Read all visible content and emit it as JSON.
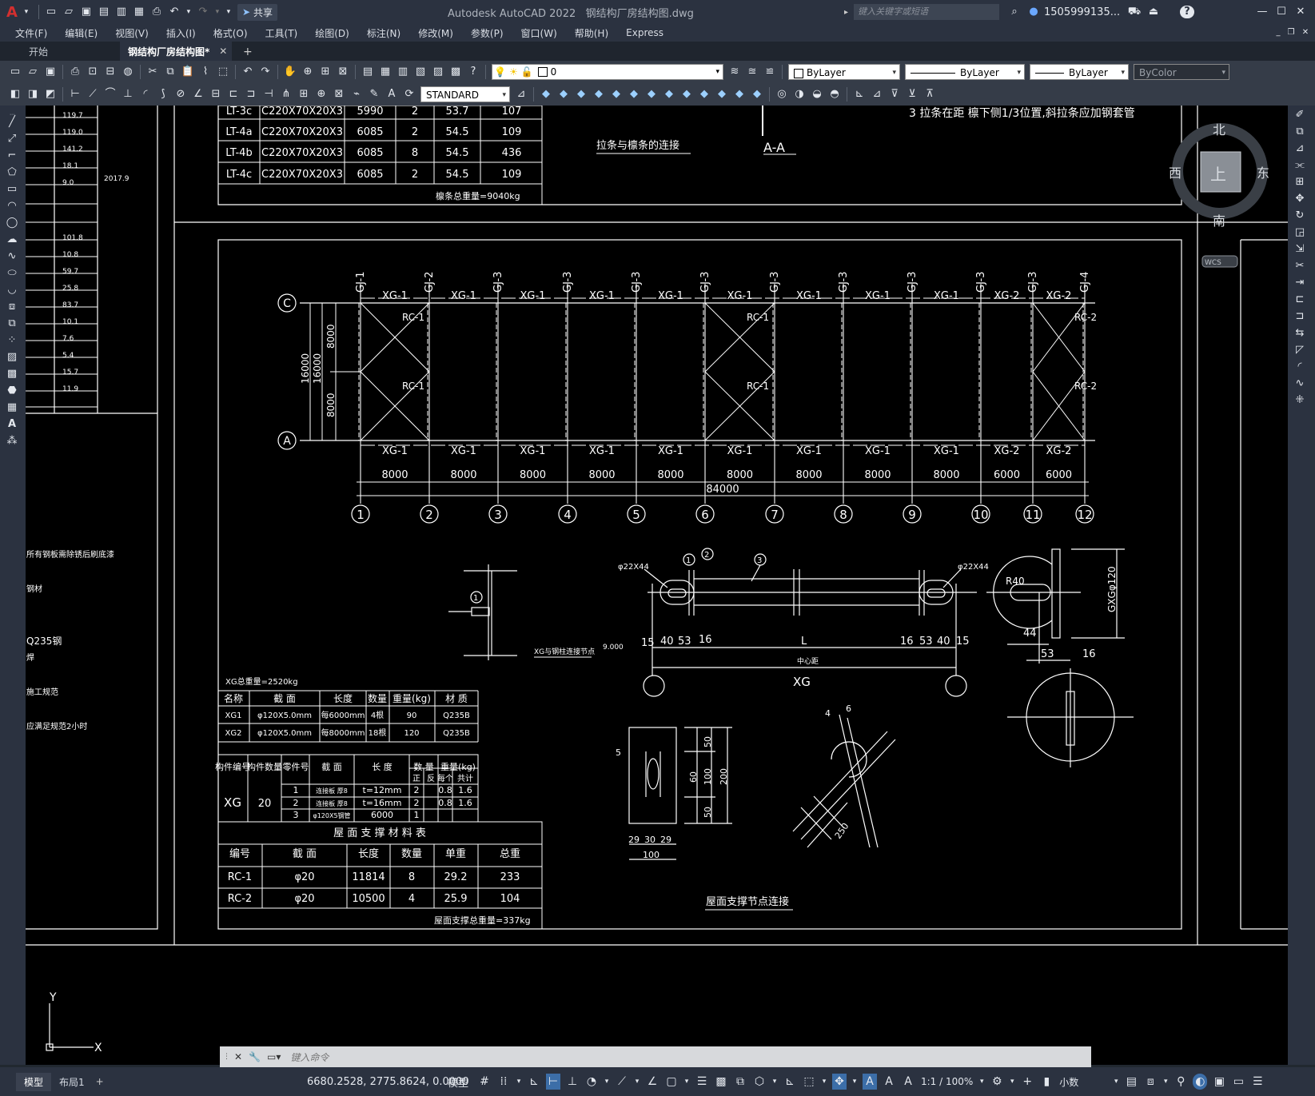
{
  "app": {
    "title": "Autodesk AutoCAD 2022",
    "filename": "钢结构厂房结构图.dwg",
    "search_placeholder": "键入关键字或短语",
    "user": "1505999135...",
    "share_label": "共享",
    "accent_color": "#d32f2f"
  },
  "menu": [
    "文件(F)",
    "编辑(E)",
    "视图(V)",
    "插入(I)",
    "格式(O)",
    "工具(T)",
    "绘图(D)",
    "标注(N)",
    "修改(M)",
    "参数(P)",
    "窗口(W)",
    "帮助(H)",
    "Express"
  ],
  "tabs": {
    "start": "开始",
    "doc": "钢结构厂房结构图*"
  },
  "properties": {
    "layer": "0",
    "color": "ByLayer",
    "linetype": "ByLayer",
    "lineweight": "ByLayer",
    "plotstyle": "ByColor",
    "textstyle": "STANDARD"
  },
  "viewcube": {
    "north": "北",
    "south": "南",
    "east": "东",
    "west": "西",
    "face": "上",
    "wcs": "WCS"
  },
  "drawing": {
    "top_table": {
      "rows": [
        [
          "LT-3c",
          "C220X70X20X3",
          "5990",
          "2",
          "53.7",
          "107"
        ],
        [
          "LT-4a",
          "C220X70X20X3",
          "6085",
          "2",
          "54.5",
          "109"
        ],
        [
          "LT-4b",
          "C220X70X20X3",
          "6085",
          "8",
          "54.5",
          "436"
        ],
        [
          "LT-4c",
          "C220X70X20X3",
          "6085",
          "2",
          "54.5",
          "109"
        ]
      ],
      "total": "檩条总重量=9040kg"
    },
    "left_column_values": [
      "119.7",
      "119.0",
      "141.2",
      "18.1",
      "9.0",
      "101.8",
      "10.8",
      "59.7",
      "25.8",
      "83.7",
      "10.1",
      "7.6",
      "5.4",
      "15.7",
      "11.9"
    ],
    "left_date": "2017.9",
    "left_notes": [
      "所有钢板需除锈后刷底漆",
      "钢材",
      "Q235钢",
      "焊",
      "施工规范",
      "应满足规范2小时"
    ],
    "note3": "3  拉条在距 檩下侧1/3位置,斜拉条应加钢套管",
    "caption_purlin": "拉条与檩条的连接",
    "section_aa": "A-A",
    "plan": {
      "frames": [
        "GJ-1",
        "GJ-2",
        "GJ-3",
        "GJ-3",
        "GJ-3",
        "GJ-3",
        "GJ-3",
        "GJ-3",
        "GJ-3",
        "GJ-3",
        "GJ-3",
        "GJ-4"
      ],
      "axes": [
        "1",
        "2",
        "3",
        "4",
        "5",
        "6",
        "7",
        "8",
        "9",
        "10",
        "11",
        "12"
      ],
      "rows": [
        "C",
        "A"
      ],
      "ties": [
        "XG-1",
        "XG-1",
        "XG-1",
        "XG-1",
        "XG-1",
        "XG-1",
        "XG-1",
        "XG-1",
        "XG-1",
        "XG-2",
        "XG-2"
      ],
      "spans": [
        "8000",
        "8000",
        "8000",
        "8000",
        "8000",
        "8000",
        "8000",
        "8000",
        "8000",
        "6000",
        "6000"
      ],
      "total": "84000",
      "vertical_dims": [
        "16000",
        "16000",
        "8000",
        "8000"
      ],
      "braces": [
        "RC-1",
        "RC-1",
        "RC-1",
        "RC-1",
        "RC-2",
        "RC-2"
      ]
    },
    "details": {
      "xg_total": "XG总重量=2520kg",
      "rod_dims": [
        "φ22X44",
        "φ22X44",
        "15",
        "40",
        "53",
        "16",
        "L",
        "16",
        "53",
        "40",
        "15"
      ],
      "center": "中心距",
      "xg_label": "XG",
      "gxg": "GXGφ120",
      "r40": "R40",
      "dim44": "44",
      "dim53": "53",
      "dim16": "16",
      "node_caption": "XG与钢柱连接节点",
      "elev": "9.000",
      "callouts": [
        "1",
        "2",
        "3"
      ],
      "plate_dims": [
        "50",
        "60",
        "100",
        "50",
        "200",
        "29",
        "30",
        "29",
        "100",
        "5",
        "250",
        "4",
        "6"
      ],
      "roof_caption": "屋面支撑节点连接"
    },
    "xg_table": {
      "header": [
        "名称",
        "截 面",
        "长度",
        "数量",
        "重量(kg)",
        "材 质"
      ],
      "rows": [
        [
          "XG1",
          "φ120X5.0mm",
          "每6000mm",
          "4根",
          "90",
          "Q235B"
        ],
        [
          "XG2",
          "φ120X5.0mm",
          "每8000mm",
          "18根",
          "120",
          "Q235B"
        ]
      ]
    },
    "part_table": {
      "header": [
        "构件编号",
        "构件数量",
        "零件号",
        "截 面",
        "长 度",
        "数 量",
        "重量(kg)"
      ],
      "sub": [
        "正",
        "反",
        "每个",
        "共计"
      ],
      "xg": "XG",
      "count": "20",
      "rows": [
        [
          "1",
          "连接板 厚8",
          "t=12mm",
          "2",
          "0.8",
          "1.6"
        ],
        [
          "2",
          "连接板 厚8",
          "t=16mm",
          "2",
          "0.8",
          "1.6"
        ],
        [
          "3",
          "φ120X5钢管",
          "6000",
          "1",
          "",
          ""
        ]
      ]
    },
    "roof_table": {
      "title": "屋 面 支 撑 材 料 表",
      "header": [
        "编号",
        "截 面",
        "长度",
        "数量",
        "单重",
        "总重"
      ],
      "rows": [
        [
          "RC-1",
          "φ20",
          "11814",
          "8",
          "29.2",
          "233"
        ],
        [
          "RC-2",
          "φ20",
          "10500",
          "4",
          "25.9",
          "104"
        ]
      ],
      "total": "屋面支撑总重量=337kg"
    },
    "ucs": {
      "x": "X",
      "y": "Y"
    }
  },
  "command": {
    "placeholder": "键入命令"
  },
  "status": {
    "tabs": [
      "模型",
      "布局1"
    ],
    "coords": "6680.2528, 2775.8624, 0.0000",
    "space": "模型",
    "scale": "1:1 / 100%",
    "units": "小数"
  }
}
